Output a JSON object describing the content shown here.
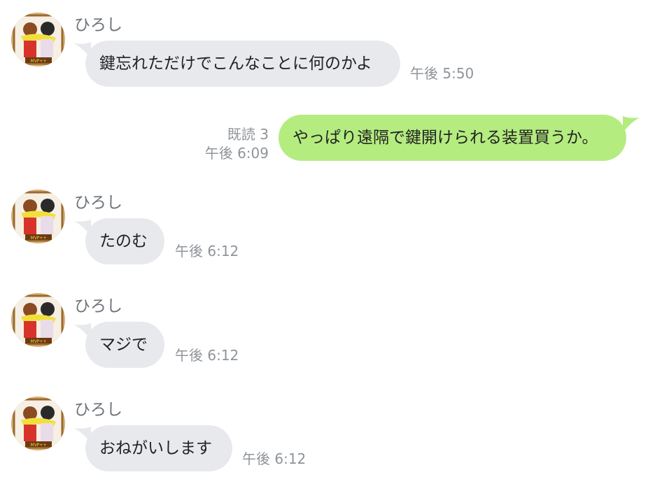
{
  "chat": {
    "messages": [
      {
        "sender": "ひろし",
        "text": "鍵忘れただけでこんなことに何のかよ",
        "time": "午後 5:50",
        "direction": "incoming"
      },
      {
        "sender": "",
        "text": "やっぱり遠隔で鍵開けられる装置買うか。",
        "time": "午後 6:09",
        "read": "既読 3",
        "direction": "outgoing"
      },
      {
        "sender": "ひろし",
        "text": "たのむ",
        "time": "午後 6:12",
        "direction": "incoming"
      },
      {
        "sender": "ひろし",
        "text": "マジで",
        "time": "午後 6:12",
        "direction": "incoming"
      },
      {
        "sender": "ひろし",
        "text": "おねがいします",
        "time": "午後 6:12",
        "direction": "incoming"
      }
    ]
  },
  "avatar": {
    "badge_text": "MVP++"
  },
  "colors": {
    "incoming_bubble": "#e7e9ec",
    "outgoing_bubble": "#b4ec80",
    "meta_text": "#8f949a",
    "name_text": "#6e737a"
  }
}
